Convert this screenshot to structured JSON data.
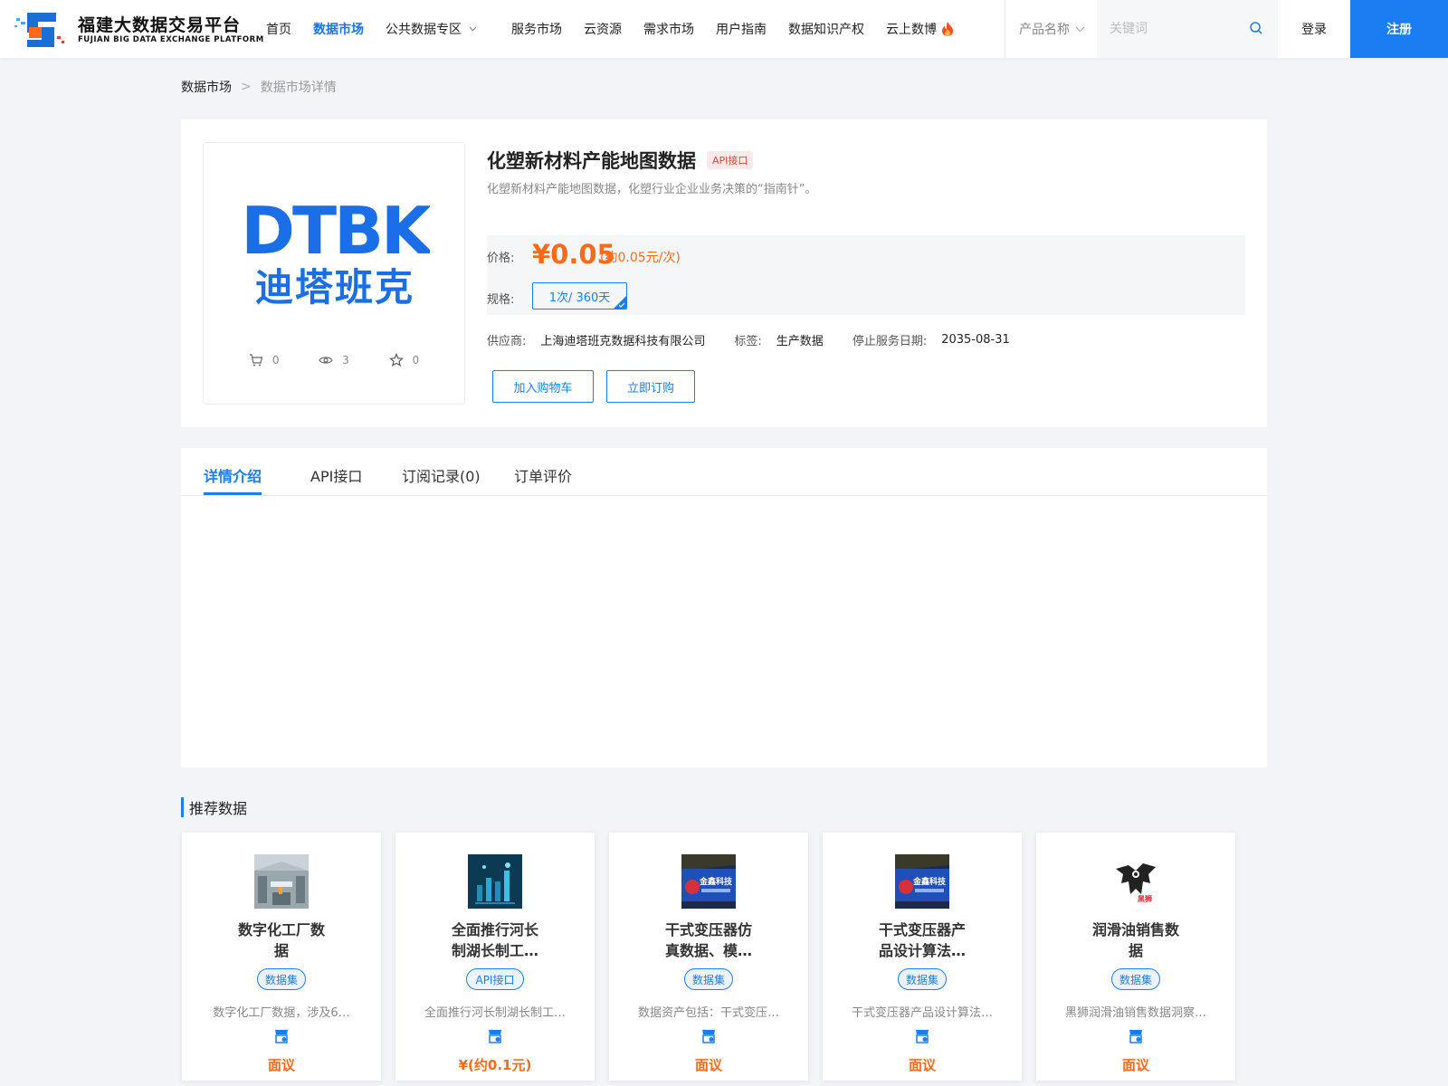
{
  "header": {
    "logo_title": "福建大数据交易平台",
    "logo_subtitle": "FUJIAN BIG DATA EXCHANGE  PLATFORM",
    "nav": [
      {
        "label": "首页"
      },
      {
        "label": "数据市场",
        "active": true
      },
      {
        "label": "公共数据专区",
        "dropdown": true
      },
      {
        "label": "服务市场"
      },
      {
        "label": "云资源"
      },
      {
        "label": "需求市场"
      },
      {
        "label": "用户指南"
      },
      {
        "label": "数据知识产权"
      },
      {
        "label": "云上数博",
        "hot": true
      }
    ],
    "product_select": "产品名称",
    "search_placeholder": "关键词",
    "login": "登录",
    "register": "注册"
  },
  "breadcrumb": {
    "root": "数据市场",
    "separator": ">",
    "current": "数据市场详情"
  },
  "product": {
    "brand_en": "DTBK",
    "brand_cn": "迪塔班克",
    "cart_count": "0",
    "view_count": "3",
    "fav_count": "0",
    "title": "化塑新材料产能地图数据",
    "type_tag": "API接口",
    "description": "化塑新材料产能地图数据，化塑行业企业业务决策的“指南针”。",
    "price_label": "价格:",
    "price": "¥0.05",
    "price_note": "(约0.05元/次)",
    "spec_label": "规格:",
    "spec_value": "1次/ 360天",
    "supplier_label": "供应商:",
    "supplier": "上海迪塔班克数据科技有限公司",
    "tag_label": "标签:",
    "tag": "生产数据",
    "stop_label": "停止服务日期:",
    "stop_date": "2035-08-31",
    "add_cart": "加入购物车",
    "buy_now": "立即订购"
  },
  "tabs": [
    "详情介绍",
    "API接口",
    "订阅记录(0)",
    "订单评价"
  ],
  "recommended": {
    "title": "推荐数据",
    "items": [
      {
        "name_line1": "数字化工厂数",
        "name_line2": "据",
        "tag": "数据集",
        "desc": "数字化工厂数据，涉及6…",
        "price": "面议",
        "image": "factory-photo"
      },
      {
        "name_line1": "全面推行河长",
        "name_line2": "制湖长制工…",
        "tag": "API接口",
        "desc": "全面推行河长制湖长制工…",
        "price": "¥(约0.1元)",
        "image": "data-tech-graphic"
      },
      {
        "name_line1": "干式变压器仿",
        "name_line2": "真数据、模…",
        "tag": "数据集",
        "desc": "数据资产包括：干式变压…",
        "price": "面议",
        "image": "jinxin-sign"
      },
      {
        "name_line1": "干式变压器产",
        "name_line2": "品设计算法…",
        "tag": "数据集",
        "desc": "干式变压器产品设计算法…",
        "price": "面议",
        "image": "jinxin-sign"
      },
      {
        "name_line1": "润滑油销售数",
        "name_line2": "据",
        "tag": "数据集",
        "desc": "黑狮润滑油销售数据洞察…",
        "price": "面议",
        "image": "black-lion-logo"
      }
    ],
    "jinxin_text": "金鑫科技",
    "lion_text": "黑狮"
  },
  "colors": {
    "accent": "#1a7ef2",
    "price": "#ff6a1a",
    "api_tag_bg": "#fde9ea",
    "api_tag_fg": "#e0453a"
  }
}
